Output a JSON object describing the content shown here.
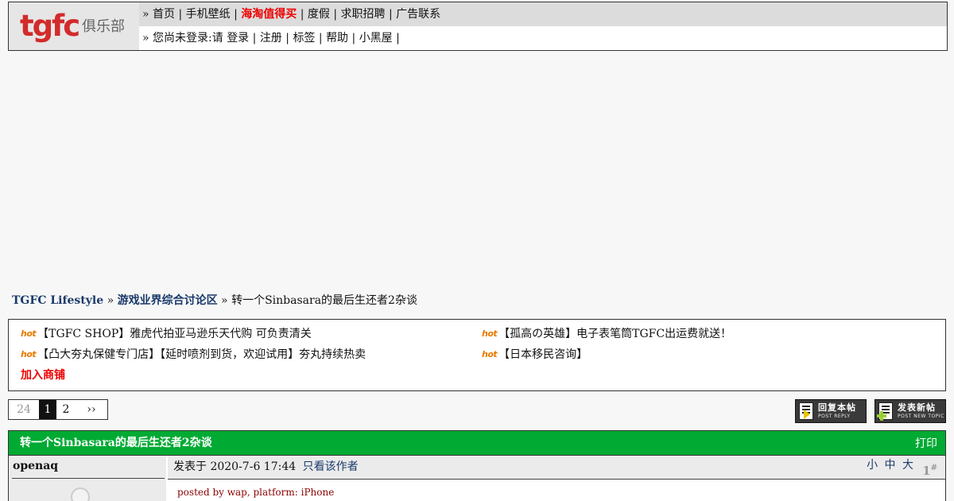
{
  "logo": {
    "word": "tgfc",
    "sub": "俱乐部"
  },
  "nav": {
    "row1_prefix": "» ",
    "row1": [
      {
        "label": "首页",
        "hot": false
      },
      {
        "label": "手机壁纸",
        "hot": false
      },
      {
        "label": "海淘值得买",
        "hot": true
      },
      {
        "label": "度假",
        "hot": false
      },
      {
        "label": "求职招聘",
        "hot": false
      },
      {
        "label": "广告联系",
        "hot": false
      }
    ],
    "row2_prefix": "» 您尚未登录:请 ",
    "row2": [
      {
        "label": "登录"
      },
      {
        "label": "注册"
      },
      {
        "label": "标签"
      },
      {
        "label": "帮助"
      },
      {
        "label": "小黑屋"
      }
    ]
  },
  "breadcrumb": {
    "forum": "TGFC Lifestyle",
    "sep": " » ",
    "board": "游戏业界综合讨论区",
    "topic": "转一个Sinbasara的最后生还者2杂谈"
  },
  "notice": {
    "hot_label": "hot",
    "items": [
      "【TGFC SHOP】雅虎代拍亚马逊乐天代购 可负责清关",
      "【孤高の英雄】电子表笔筒TGFC出运费就送！",
      "【凸大夯丸保健专门店】【延时喷剂到货，欢迎试用】夯丸持续热卖",
      "【日本移民咨询】"
    ],
    "join_label": "加入商铺"
  },
  "pager": {
    "last": "24",
    "current": "1",
    "next_page": "2",
    "next_label": "››"
  },
  "actions": {
    "reply": {
      "label": "回复本帖",
      "sub": "POST REPLY"
    },
    "new_topic": {
      "label": "发表新帖",
      "sub": "POST NEW TOPIC"
    }
  },
  "thread": {
    "title": "转一个Sinbasara的最后生还者2杂谈",
    "print_label": "打印"
  },
  "post": {
    "author": "openaq",
    "posted_time": "发表于 2020-7-6 17:44",
    "only_author_label": "只看该作者",
    "size_small": "小",
    "size_medium": "中",
    "size_large": "大",
    "floor": "1",
    "floor_mark": "#",
    "posted_by": "posted by wap, platform: iPhone"
  },
  "colors": {
    "thread_bar": "#00aa33",
    "hot_link": "#ee0000",
    "link_blue": "#1a3a6a"
  }
}
